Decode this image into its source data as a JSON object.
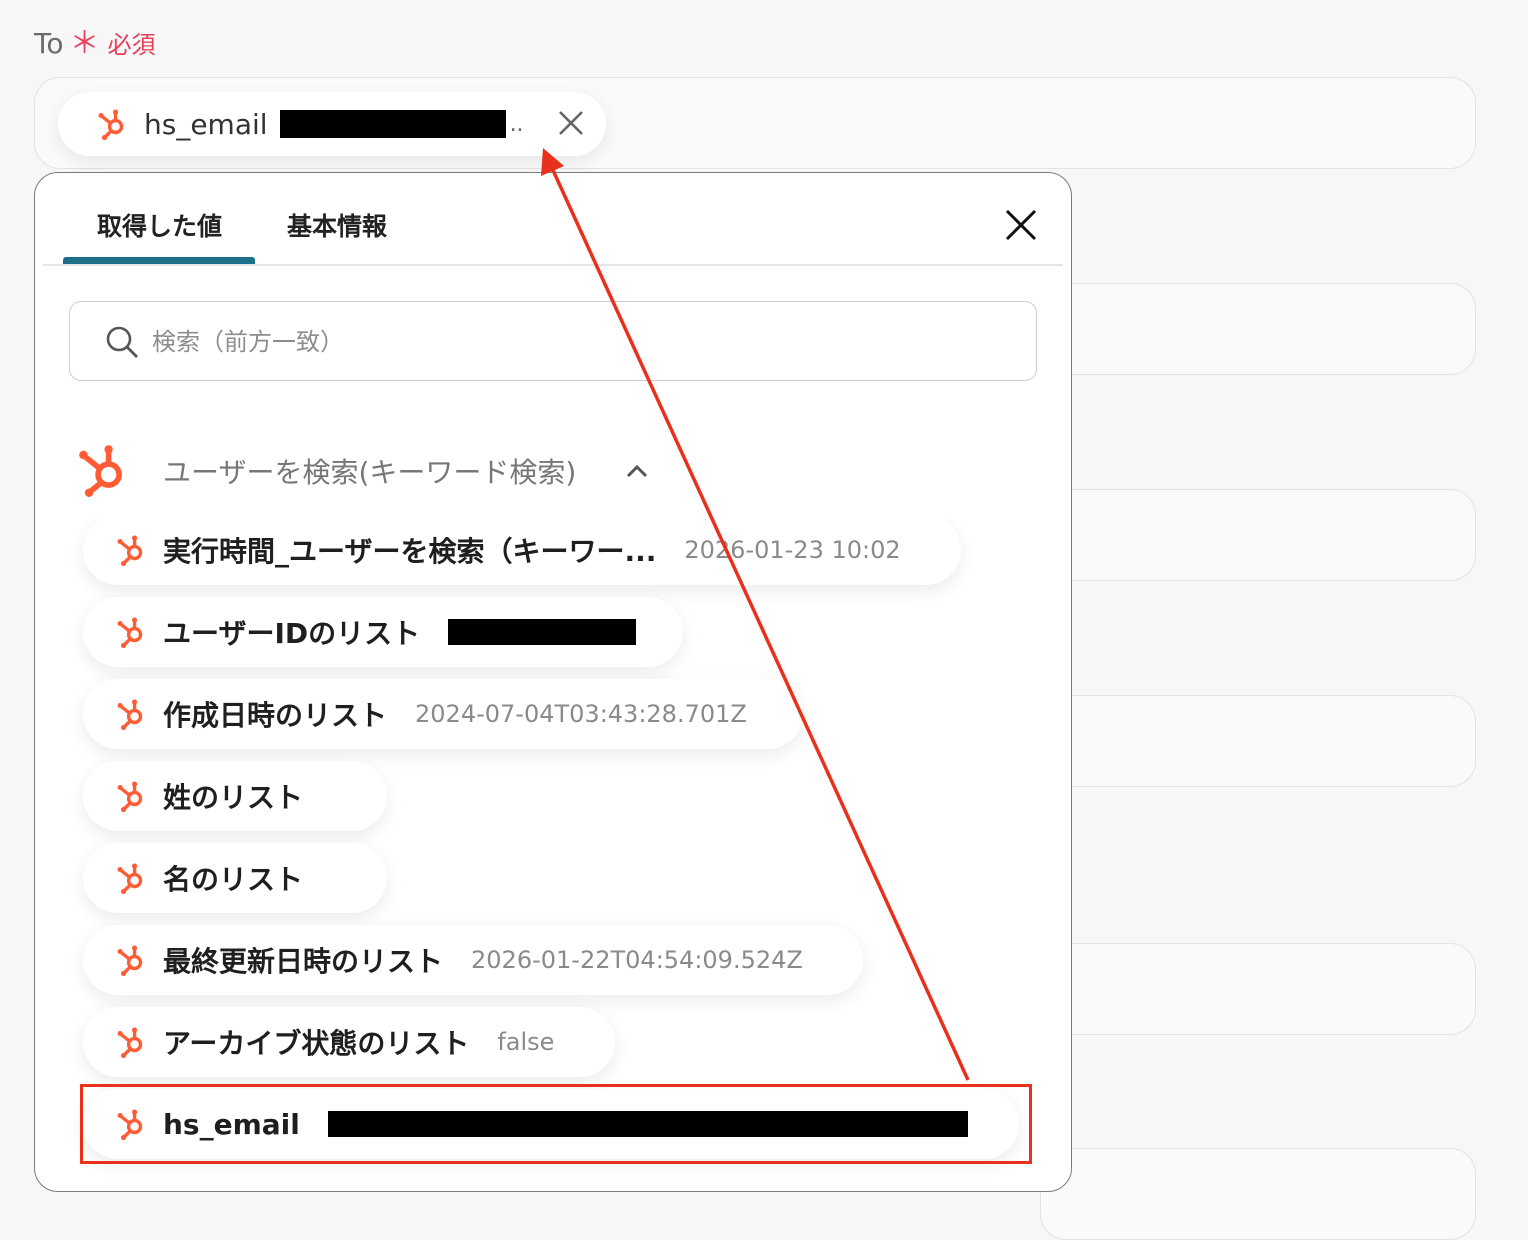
{
  "field": {
    "label": "To",
    "required_mark": "＊",
    "required_text": "必須",
    "selected_chip": {
      "name": "hs_email",
      "truncation": "..",
      "icon": "hubspot-icon",
      "remove_icon": "close-icon"
    }
  },
  "panel": {
    "tabs": [
      {
        "label": "取得した値",
        "active": true
      },
      {
        "label": "基本情報",
        "active": false
      }
    ],
    "close_icon": "close-icon",
    "search": {
      "placeholder": "検索（前方一致）",
      "value": "",
      "icon": "search-icon"
    },
    "group": {
      "title": "ユーザーを検索(キーワード検索)",
      "icon": "hubspot-icon",
      "expanded": true,
      "toggle_icon": "chevron-up-icon"
    },
    "items": [
      {
        "name": "実行時間_ユーザーを検索（キーワー...",
        "value": "2026-01-23 10:02"
      },
      {
        "name": "ユーザーIDのリスト",
        "value": ""
      },
      {
        "name": "作成日時のリスト",
        "value": "2024-07-04T03:43:28.701Z"
      },
      {
        "name": "姓のリスト",
        "value": ""
      },
      {
        "name": "名のリスト",
        "value": ""
      },
      {
        "name": "最終更新日時のリスト",
        "value": "2026-01-22T04:54:09.524Z"
      },
      {
        "name": "アーカイブ状態のリスト",
        "value": "false"
      },
      {
        "name": "hs_email",
        "value": ""
      }
    ]
  },
  "colors": {
    "hubspot_orange": "#ff5c35",
    "tab_underline": "#1b6f8a",
    "annotation_red": "#e8311a",
    "required_red": "#e8405a"
  }
}
